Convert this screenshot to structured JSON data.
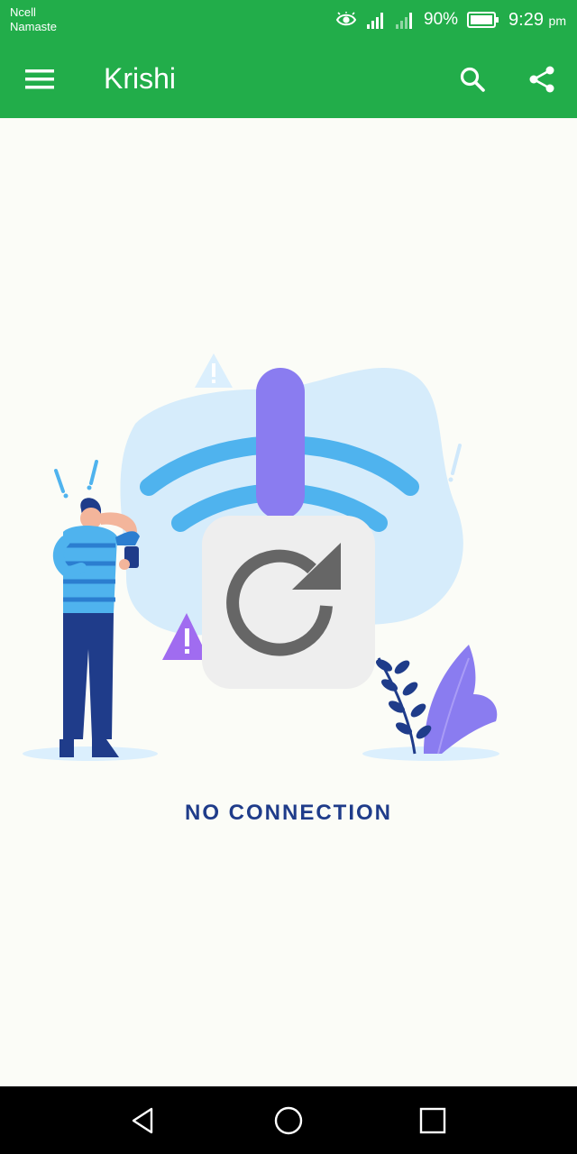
{
  "status_bar": {
    "carrier_line1": "Ncell",
    "carrier_line2": "Namaste",
    "battery_percent": "90%",
    "time": "9:29",
    "ampm": "pm"
  },
  "app_bar": {
    "title": "Krishi"
  },
  "icons": {
    "menu": "hamburger-menu-icon",
    "search": "search-icon",
    "share": "share-icon",
    "reload": "reload-icon"
  },
  "empty_state": {
    "message": "NO CONNECTION"
  },
  "colors": {
    "app_bar": "#22ad4a",
    "message": "#1f3c8a",
    "reload_tile": "#eeeeee",
    "reload_icon": "#666666"
  }
}
